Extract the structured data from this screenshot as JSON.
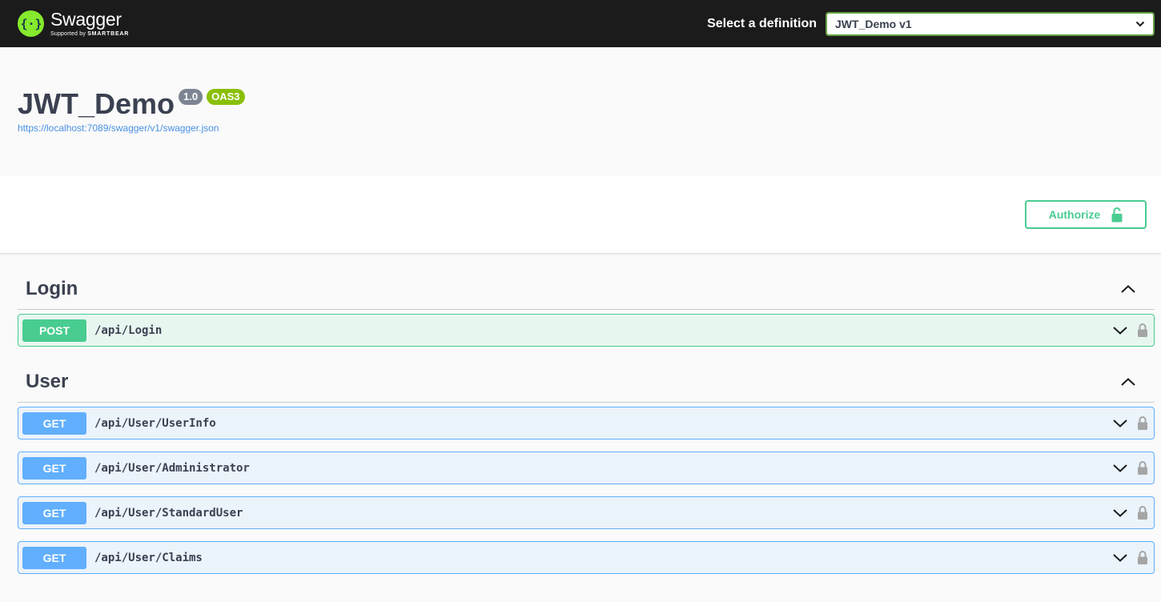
{
  "topbar": {
    "logo_name": "Swagger",
    "logo_sub_prefix": "Supported by",
    "logo_sub_brand": "SMARTBEAR",
    "definition_label": "Select a definition",
    "definition_selected": "JWT_Demo v1"
  },
  "info": {
    "title": "JWT_Demo",
    "version": "1.0",
    "oas": "OAS3",
    "spec_url": "https://localhost:7089/swagger/v1/swagger.json"
  },
  "authorize": {
    "label": "Authorize"
  },
  "tags": [
    {
      "name": "Login",
      "operations": [
        {
          "method": "POST",
          "path": "/api/Login"
        }
      ]
    },
    {
      "name": "User",
      "operations": [
        {
          "method": "GET",
          "path": "/api/User/UserInfo"
        },
        {
          "method": "GET",
          "path": "/api/User/Administrator"
        },
        {
          "method": "GET",
          "path": "/api/User/StandardUser"
        },
        {
          "method": "GET",
          "path": "/api/User/Claims"
        }
      ]
    }
  ],
  "colors": {
    "topbar_bg": "#1b1b1b",
    "logo_green": "#85ea2d",
    "post": "#49cc90",
    "get": "#61affe",
    "version_badge": "#7d8492",
    "oas_badge": "#89bf04",
    "link": "#4990e2"
  },
  "icons": {
    "logo": "swagger-braces-icon",
    "select_chevron": "chevron-down-icon",
    "authorize": "unlocked-padlock-icon",
    "tag_toggle": "chevron-up-icon",
    "operation_toggle": "chevron-down-icon",
    "operation_lock": "padlock-icon"
  }
}
